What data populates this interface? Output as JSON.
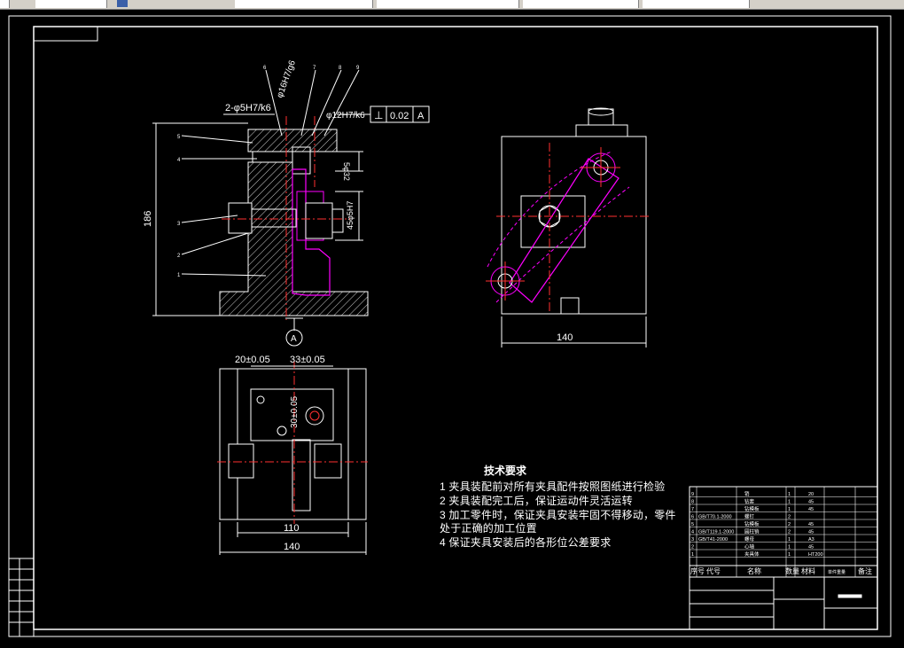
{
  "drawing": {
    "dims": {
      "d1": "2-φ5H7/k6",
      "d2": "φ16H7/g6",
      "d3": "φ12H7/k6",
      "tolerance_symbol": "⊥",
      "tolerance_value": "0.02",
      "datum": "A",
      "height": "186",
      "side_dim1": "5φ32",
      "side_dim2": "45φ5H7",
      "datum_marker": "A",
      "right_width": "140",
      "bottom_d1": "20±0.05",
      "bottom_d2": "33±0.05",
      "bottom_d3": "30±0.05",
      "bottom_w1": "110",
      "bottom_w2": "140"
    },
    "leaders": [
      "1",
      "2",
      "3",
      "4",
      "5",
      "6",
      "7",
      "8",
      "9"
    ]
  },
  "requirements": {
    "title": "技术要求",
    "items": [
      "1  夹具装配前对所有夹具配件按照图纸进行检验",
      "2  夹具装配完工后，保证运动件灵活运转",
      "3  加工零件时，保证夹具安装牢固不得移动，零件",
      "    处于正确的加工位置",
      "4  保证夹具安装后的各形位公差要求"
    ]
  },
  "bom": {
    "header": [
      "序号",
      "代号",
      "名称",
      "数量",
      "材料",
      "单件重量",
      "备注"
    ],
    "rows": [
      {
        "no": "9",
        "code": "",
        "name": "销",
        "qty": "1",
        "mat": "20"
      },
      {
        "no": "8",
        "code": "",
        "name": "钻套",
        "qty": "1",
        "mat": "45"
      },
      {
        "no": "7",
        "code": "",
        "name": "钻模板",
        "qty": "1",
        "mat": "45"
      },
      {
        "no": "6",
        "code": "GB/T70.1-2000",
        "name": "螺钉",
        "qty": "2",
        "mat": ""
      },
      {
        "no": "5",
        "code": "",
        "name": "钻模板",
        "qty": "2",
        "mat": "45"
      },
      {
        "no": "4",
        "code": "GB/T119.1-2000",
        "name": "圆柱销",
        "qty": "2",
        "mat": "45"
      },
      {
        "no": "3",
        "code": "GB/T41-2000",
        "name": "螺母",
        "qty": "1",
        "mat": "A3"
      },
      {
        "no": "2",
        "code": "",
        "name": "心轴",
        "qty": "1",
        "mat": "45"
      },
      {
        "no": "1",
        "code": "",
        "name": "夹具体",
        "qty": "1",
        "mat": "HT200"
      }
    ]
  }
}
